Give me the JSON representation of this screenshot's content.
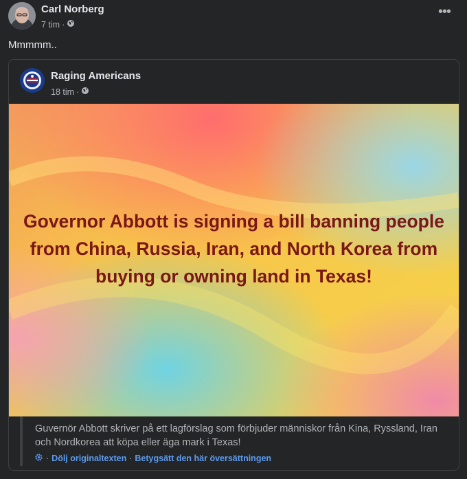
{
  "post": {
    "author": "Carl Norberg",
    "time": "7 tim",
    "dot": "·",
    "audience_icon": "globe-icon",
    "more_icon": "more-options-icon",
    "more_label": "•••",
    "text": "Mmmmm.."
  },
  "shared_post": {
    "page_name": "Raging Americans",
    "time": "18 tim",
    "dot": "·",
    "audience_icon": "globe-icon",
    "image_text": "Governor Abbott is signing a bill banning people from China, Russia, Iran, and North Korea from buying or owning land in Texas!"
  },
  "translation": {
    "text": "Guvernör Abbott skriver på ett lagförslag som förbjuder människor från Kina, Ryssland, Iran och Nordkorea att köpa eller äga mark i Texas!",
    "icon": "gear-icon",
    "hide_original": "Dölj originaltexten",
    "separator": "·",
    "rate_translation": "Betygsätt den här översättningen",
    "link_color": "#5b9cf3"
  },
  "colors": {
    "background": "#242526",
    "primary_text": "#e4e6eb",
    "secondary_text": "#b0b3b8",
    "image_text": "#7a1717"
  }
}
